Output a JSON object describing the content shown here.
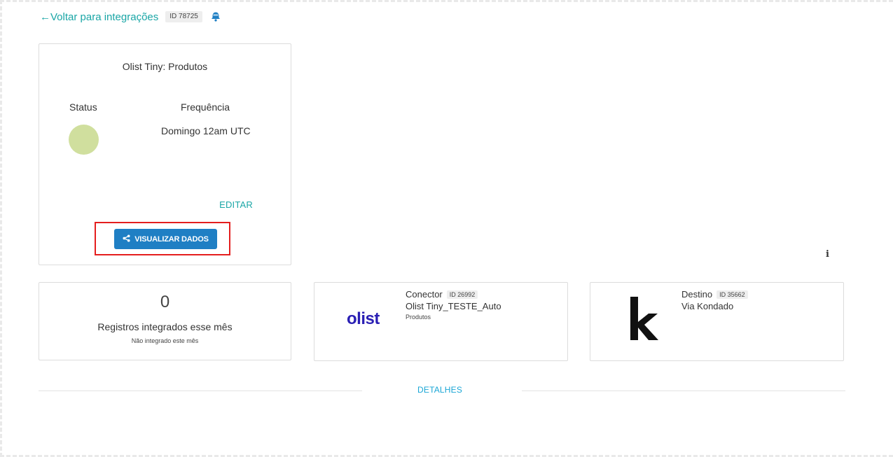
{
  "header": {
    "back_label": "←Voltar para integrações",
    "id_label": "ID 78725",
    "icons": {
      "notify": "bell-alert-icon"
    }
  },
  "integration": {
    "title": "Olist Tiny: Produtos",
    "status_label": "Status",
    "frequency_label": "Frequência",
    "frequency_value": "Domingo 12am UTC",
    "status_color": "#d0df9e",
    "edit_label": "EDITAR",
    "view_button_label": "VISUALIZAR DADOS",
    "view_button_icon": "share-icon"
  },
  "records": {
    "count": "0",
    "label": "Registros integrados esse mês",
    "sub": "Não integrado este mês"
  },
  "connector": {
    "logo_text": "olist",
    "heading": "Conector",
    "id_label": "ID 26992",
    "name": "Olist Tiny_TESTE_Auto",
    "sub": "Produtos"
  },
  "destination": {
    "logo": "kondado-k-logo",
    "heading": "Destino",
    "id_label": "ID 35662",
    "name": "Via Kondado"
  },
  "details": {
    "label": "DETALHES"
  },
  "info_icon": "i",
  "colors": {
    "accent_teal": "#1aa6a6",
    "primary_button": "#1f7fc4",
    "highlight_red": "#e41e1e",
    "olist_brand": "#2a1fb4"
  }
}
